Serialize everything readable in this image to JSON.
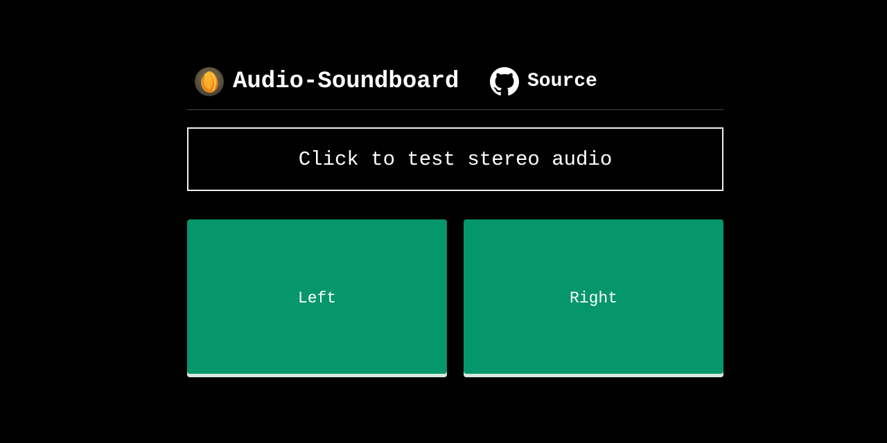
{
  "header": {
    "title": "Audio-Soundboard",
    "logo_icon": "tulip-flower-avatar",
    "source_label": "Source",
    "source_icon": "github-icon"
  },
  "main": {
    "test_button_label": "Click to test stereo audio",
    "channels": [
      {
        "label": "Left"
      },
      {
        "label": "Right"
      }
    ]
  },
  "colors": {
    "background": "#000000",
    "channel_button": "#06966b",
    "border": "#f0f0f0",
    "divider": "#4a4c5a"
  }
}
